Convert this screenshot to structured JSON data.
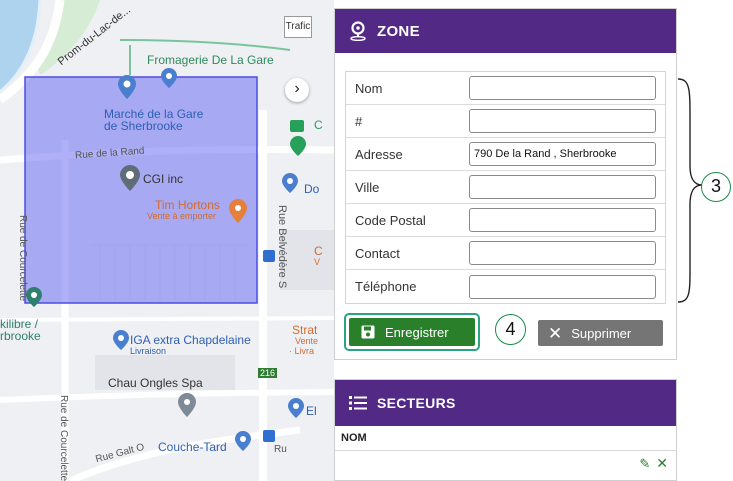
{
  "map": {
    "traffic_button": "Trafic",
    "labels": {
      "street_prom": "Prom-du-Lac-de...",
      "fromagerie": "Fromagerie De La Gare",
      "marche": "Marché de la Gare\nde Sherbrooke",
      "rue_de_la_rand": "Rue de la Rand",
      "rue_de_courcelette": "Rue de Courcelette",
      "cgi": "CGI inc",
      "tim_hortons": "Tim Hortons",
      "tim_hortons_sub": "Vente à emporter",
      "rue_belvedere": "Rue Belvédère S",
      "equilibre": "kilibre /\nrbrooke",
      "iga": "IGA extra Chapdelaine",
      "iga_sub": "Livraison",
      "chau": "Chau Ongles Spa",
      "strat": "Strat",
      "strat_sub1": "Vente",
      "strat_sub2": "· Livra",
      "couche_tard": "Couche-Tard",
      "rue_galt": "Rue Galt O",
      "route_badge": "216",
      "do": "Do",
      "el": "El",
      "ru": "Ru",
      "c_letter": "C",
      "v_letter": "V",
      "c2": "C",
      "rue_de_courcelette_2": "Rue de Courcelette"
    }
  },
  "zone": {
    "title": "ZONE",
    "fields": [
      {
        "label": "Nom",
        "value": ""
      },
      {
        "label": "#",
        "value": ""
      },
      {
        "label": "Adresse",
        "value": "790 De la Rand , Sherbrooke"
      },
      {
        "label": "Ville",
        "value": ""
      },
      {
        "label": "Code Postal",
        "value": ""
      },
      {
        "label": "Contact",
        "value": ""
      },
      {
        "label": "Téléphone",
        "value": ""
      }
    ],
    "save_label": "Enregistrer",
    "delete_label": "Supprimer",
    "callout_form": "3",
    "callout_save": "4"
  },
  "secteurs": {
    "title": "SECTEURS",
    "column": "NOM"
  },
  "colors": {
    "header_purple": "#522a86",
    "save_green": "#2a7f2a",
    "highlight_teal": "#2aa381",
    "delete_gray": "#757575",
    "zone_overlay": "#6d6ff0"
  }
}
